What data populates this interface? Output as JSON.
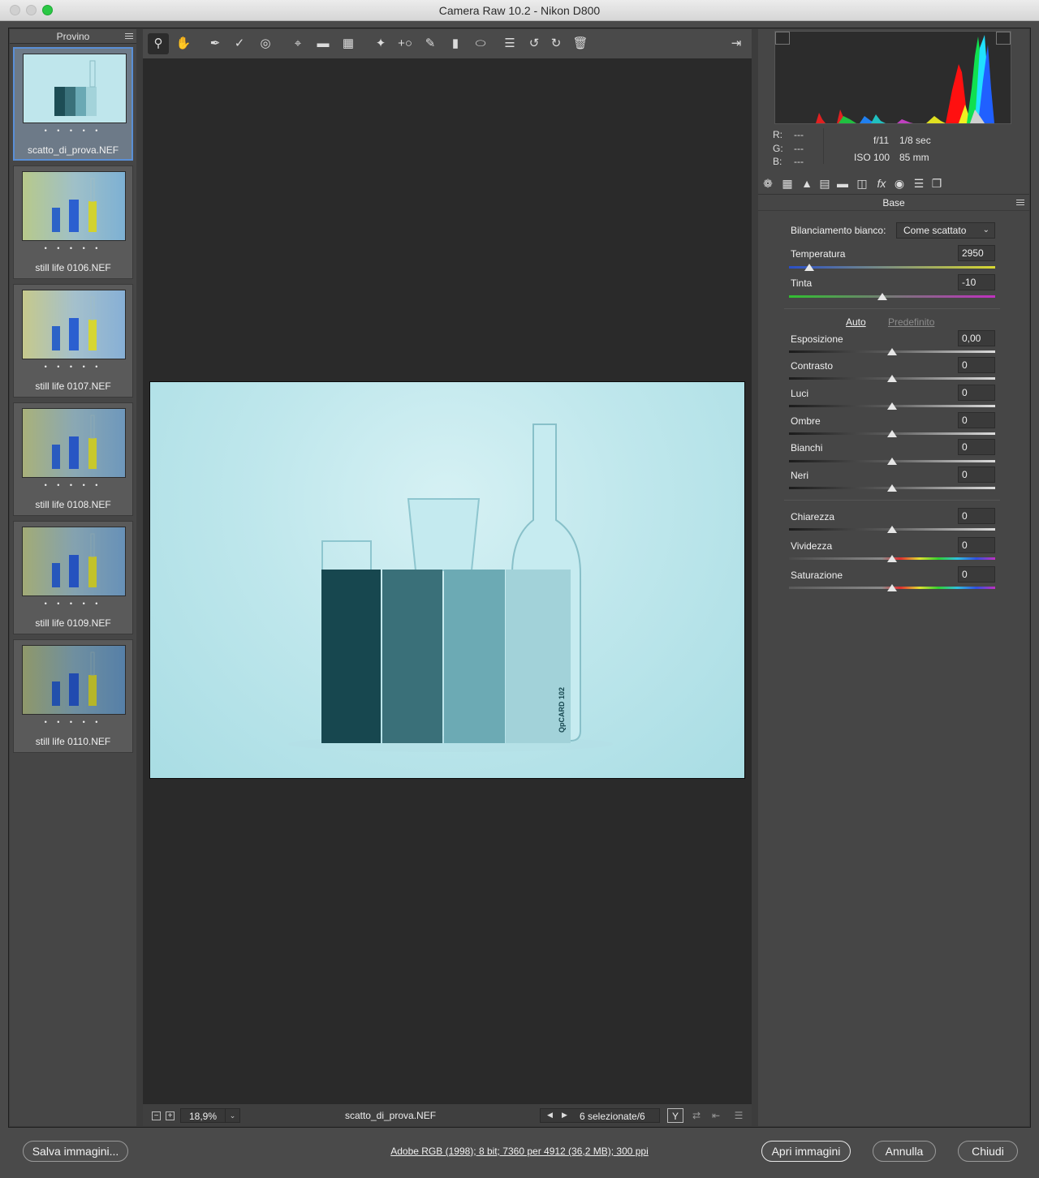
{
  "window": {
    "title": "Camera Raw 10.2  -  Nikon D800"
  },
  "filmstrip": {
    "header": "Provino",
    "items": [
      {
        "name": "scatto_di_prova.NEF",
        "dots": "• • • • •",
        "selected": true
      },
      {
        "name": "still life 0106.NEF",
        "dots": "• • • • •",
        "selected": false
      },
      {
        "name": "still life 0107.NEF",
        "dots": "• • • • •",
        "selected": false
      },
      {
        "name": "still life 0108.NEF",
        "dots": "• • • • •",
        "selected": false
      },
      {
        "name": "still life 0109.NEF",
        "dots": "• • • • •",
        "selected": false
      },
      {
        "name": "still life 0110.NEF",
        "dots": "• • • • •",
        "selected": false
      }
    ]
  },
  "toolbar": {
    "tools": [
      "zoom-icon",
      "hand-icon",
      "white-balance-icon",
      "color-sampler-icon",
      "target-adjust-icon",
      "crop-icon",
      "straighten-icon",
      "transform-icon",
      "spot-removal-icon",
      "red-eye-icon",
      "adjustment-brush-icon",
      "graduated-filter-icon",
      "radial-filter-icon",
      "presets-list-icon",
      "rotate-left-icon",
      "rotate-right-icon",
      "trash-icon",
      "export-icon"
    ]
  },
  "photo": {
    "card_label": "QpCARD 102"
  },
  "status": {
    "zoom": "18,9%",
    "filename": "scatto_di_prova.NEF",
    "selection": "6 selezionate/6"
  },
  "readout": {
    "r": "R:",
    "g": "G:",
    "b": "B:",
    "r_val": "---",
    "g_val": "---",
    "b_val": "---",
    "aperture": "f/11",
    "shutter": "1/8 sec",
    "iso": "ISO 100",
    "focal": "85 mm"
  },
  "panel": {
    "title": "Base",
    "wb_label": "Bilanciamento bianco:",
    "wb_value": "Come scattato",
    "auto": "Auto",
    "default": "Predefinito",
    "controls": {
      "temperatura": {
        "label": "Temperatura",
        "value": "2950"
      },
      "tinta": {
        "label": "Tinta",
        "value": "-10"
      },
      "esposizione": {
        "label": "Esposizione",
        "value": "0,00"
      },
      "contrasto": {
        "label": "Contrasto",
        "value": "0"
      },
      "luci": {
        "label": "Luci",
        "value": "0"
      },
      "ombre": {
        "label": "Ombre",
        "value": "0"
      },
      "bianchi": {
        "label": "Bianchi",
        "value": "0"
      },
      "neri": {
        "label": "Neri",
        "value": "0"
      },
      "chiarezza": {
        "label": "Chiarezza",
        "value": "0"
      },
      "vividezza": {
        "label": "Vividezza",
        "value": "0"
      },
      "saturazione": {
        "label": "Saturazione",
        "value": "0"
      }
    }
  },
  "bottom": {
    "save": "Salva immagini...",
    "info": "Adobe RGB (1998); 8 bit; 7360 per 4912 (36,2 MB); 300 ppi",
    "open": "Apri immagini",
    "cancel": "Annulla",
    "close": "Chiudi"
  },
  "colors": {
    "accent": "#5a8fd6",
    "window_bg": "#3c3c3c",
    "preview_bg": "#2a2a2a"
  }
}
